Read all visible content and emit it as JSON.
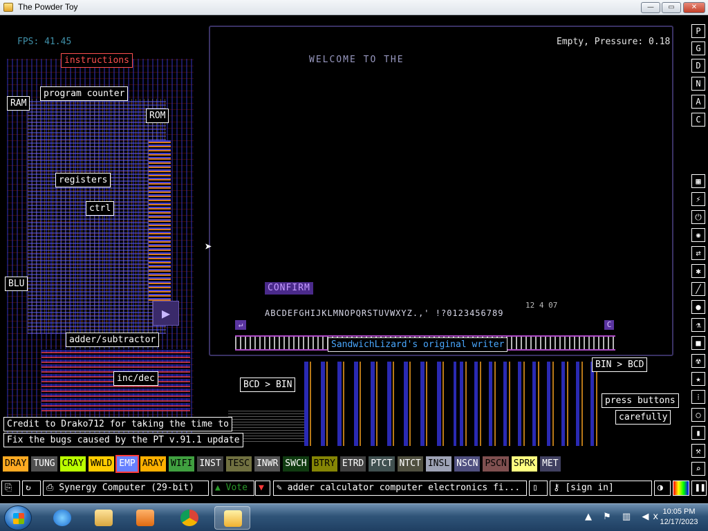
{
  "window": {
    "title": "The Powder Toy",
    "min": "—",
    "max": "▭",
    "close": "✕"
  },
  "hud": {
    "fps": "FPS: 41.45",
    "pressure": "Empty, Pressure: 0.18"
  },
  "screen": {
    "welcome": "WELCOME TO THE",
    "confirm": "CONFIRM",
    "alphabet": "ABCDEFGHIJKLMNOPQRSTUVWXYZ.,' !?0123456789",
    "top_numbers": "12  4  07",
    "back": "↵",
    "clear": "C"
  },
  "labels": {
    "instructions": "instructions",
    "program_counter": "program counter",
    "ram": "RAM",
    "rom": "ROM",
    "registers": "registers",
    "ctrl": "ctrl",
    "alu": "BLU",
    "adder": "adder/subtractor",
    "incdec": "inc/dec",
    "bcd_bin": "BCD > BIN",
    "bin_bcd": "BIN > BCD",
    "writer": "SandwichLizard's original writer",
    "press1": "press buttons",
    "press2": "carefully",
    "credit1": "Credit to Drako712 for taking the time to",
    "credit2": "Fix the bugs caused by the PT v.91.1 update"
  },
  "side_buttons": [
    "P",
    "G",
    "D",
    "N",
    "A",
    "C"
  ],
  "tool_icons": [
    "grid-icon",
    "plug-icon",
    "power-icon",
    "explosion-icon",
    "arrows-icon",
    "spray-icon",
    "pen-icon",
    "drop-icon",
    "flask-icon",
    "square-icon",
    "radiation-icon",
    "star-icon",
    "dots-icon",
    "bulb-icon",
    "bookmark-icon",
    "tool-icon",
    "search-icon"
  ],
  "tool_glyphs": [
    "▦",
    "⚡",
    "⏻",
    "✺",
    "⇄",
    "✱",
    "╱",
    "●",
    "⚗",
    "■",
    "☢",
    "★",
    "⁞",
    "○",
    "▮",
    "⚒",
    "⌕"
  ],
  "elements": [
    {
      "name": "DRAY",
      "color": "#ffaa22"
    },
    {
      "name": "TUNG",
      "color": "#505050",
      "text": "#fff"
    },
    {
      "name": "CRAY",
      "color": "#bbff00"
    },
    {
      "name": "WWLD",
      "color": "#ffcc00"
    },
    {
      "name": "EMP",
      "color": "#6680ff",
      "selected": true
    },
    {
      "name": "ARAY",
      "color": "#ffb000"
    },
    {
      "name": "WIFI",
      "color": "#40a040"
    },
    {
      "name": "INST",
      "color": "#404040",
      "text": "#fff"
    },
    {
      "name": "TESC",
      "color": "#707040"
    },
    {
      "name": "INWR",
      "color": "#545454",
      "text": "#fff"
    },
    {
      "name": "SWCH",
      "color": "#103b11",
      "text": "#fff"
    },
    {
      "name": "BTRY",
      "color": "#858505"
    },
    {
      "name": "ETRD",
      "color": "#404040",
      "text": "#fff"
    },
    {
      "name": "PTCT",
      "color": "#405050",
      "text": "#fff"
    },
    {
      "name": "NTCT",
      "color": "#505040",
      "text": "#fff"
    },
    {
      "name": "INSL",
      "color": "#9ea3b6"
    },
    {
      "name": "NSCN",
      "color": "#505080",
      "text": "#fff"
    },
    {
      "name": "PSCN",
      "color": "#805050"
    },
    {
      "name": "SPRK",
      "color": "#ffff80"
    },
    {
      "name": "MET",
      "color": "#404060",
      "text": "#fff"
    }
  ],
  "bottom": {
    "save_title": "Synergy Computer (29-bit)",
    "vote": "Vote",
    "tags": "adder calculator computer electronics fi...",
    "signin": "[sign in]"
  },
  "taskbar": {
    "time": "10:05 PM",
    "date": "12/17/2023",
    "apps": [
      "internet-explorer-icon",
      "file-explorer-icon",
      "media-player-icon",
      "chrome-icon",
      "powder-toy-icon"
    ]
  },
  "colors": {
    "accent_purple": "#5a34a0",
    "label_red": "#ff5050",
    "fps": "#3f8fa8"
  }
}
